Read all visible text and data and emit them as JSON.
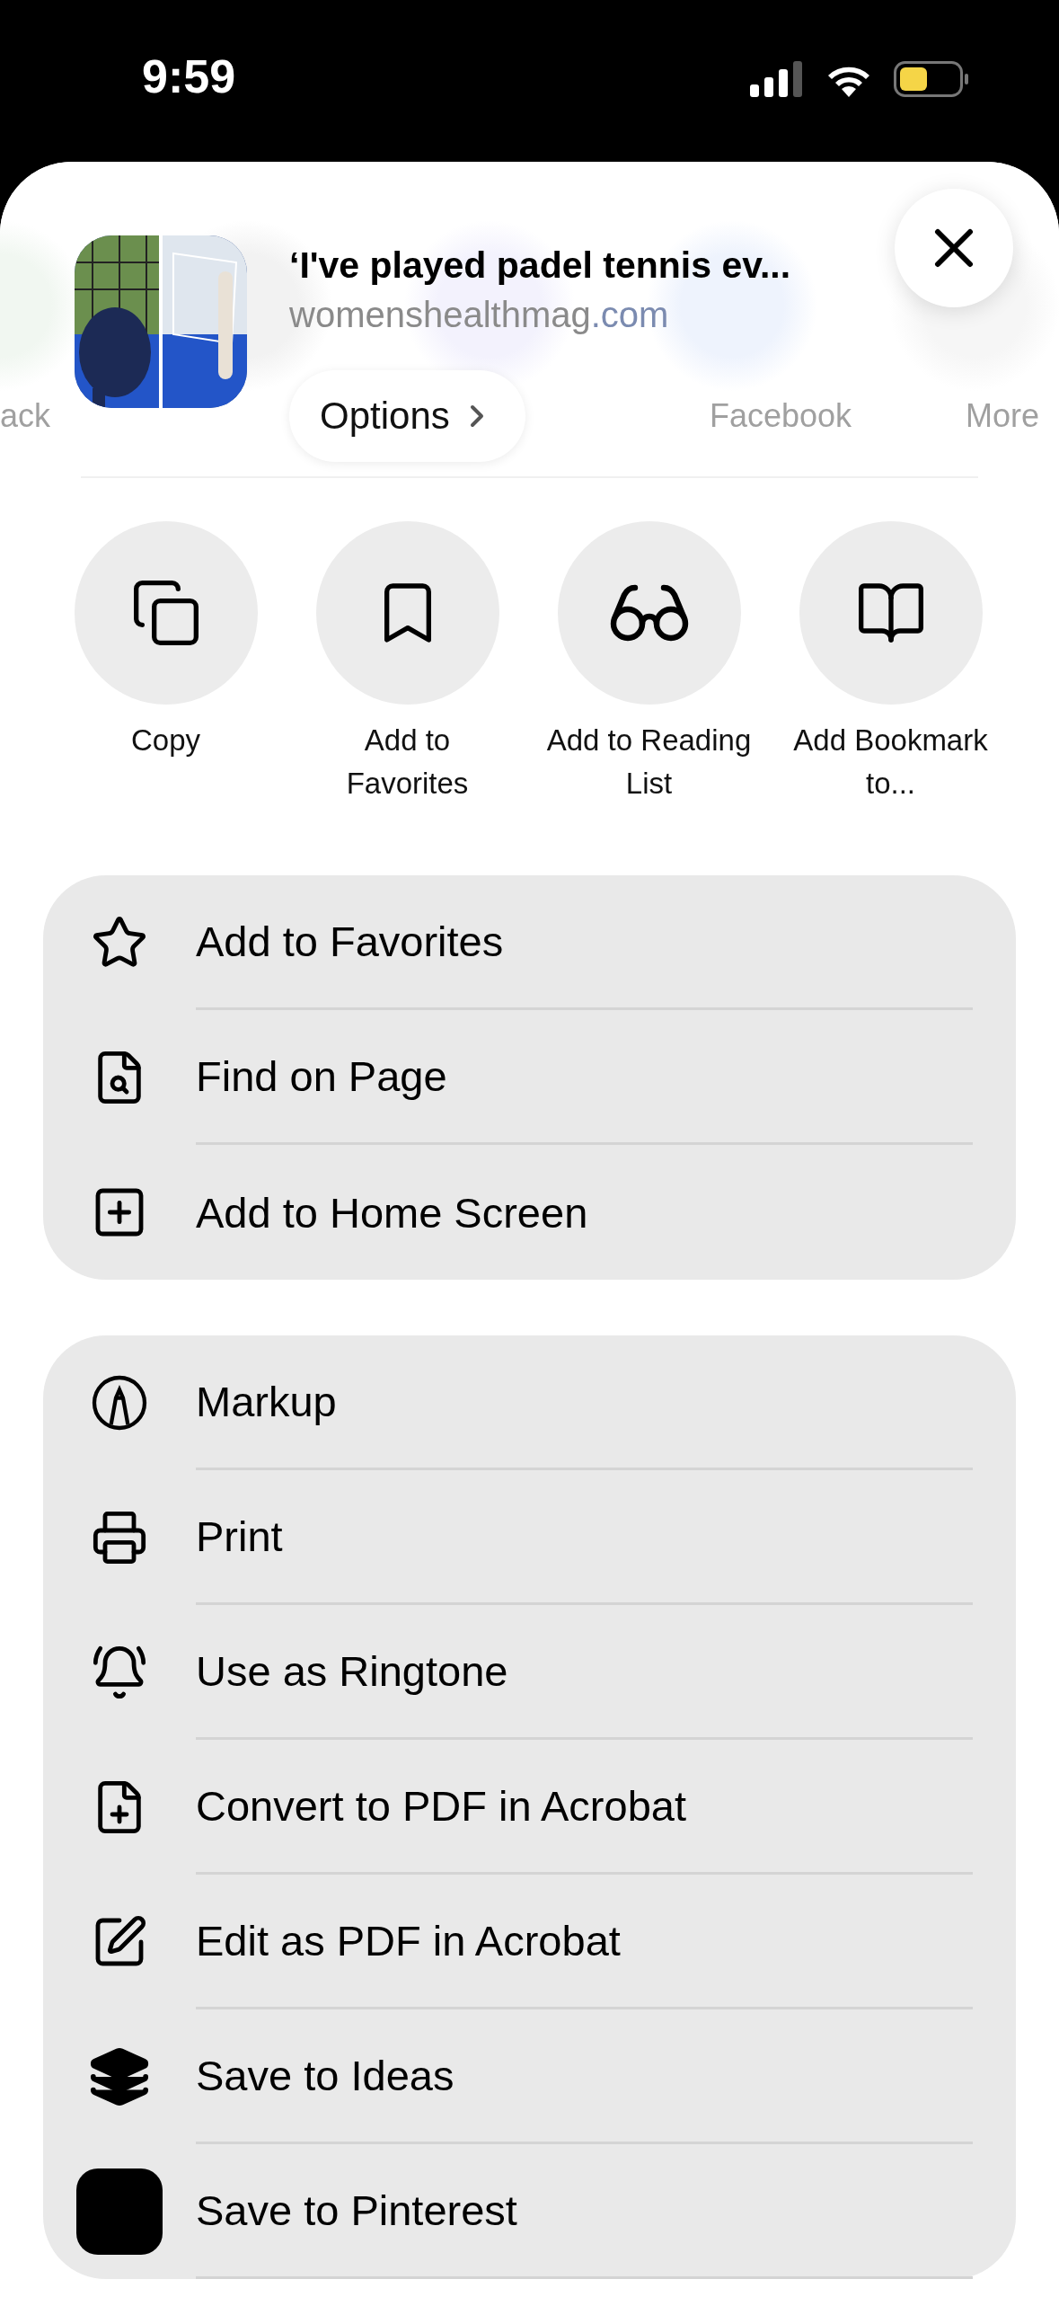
{
  "status_bar": {
    "time": "9:59"
  },
  "background_apps": [
    {
      "label": "ack"
    },
    {
      "label": "Facebook"
    },
    {
      "label": "More"
    }
  ],
  "header": {
    "title": "‘I've played padel tennis ev...",
    "domain_name": "womenshealthmag",
    "domain_tld": ".com",
    "options": "Options"
  },
  "actions": [
    {
      "label": "Copy"
    },
    {
      "label": "Add to Favorites"
    },
    {
      "label": "Add to Reading List"
    },
    {
      "label": "Add Bookmark to..."
    }
  ],
  "groups": [
    {
      "items": [
        {
          "label": "Add to Favorites"
        },
        {
          "label": "Find on Page"
        },
        {
          "label": "Add to Home Screen"
        }
      ]
    },
    {
      "items": [
        {
          "label": "Markup"
        },
        {
          "label": "Print"
        },
        {
          "label": "Use as Ringtone"
        },
        {
          "label": "Convert to PDF in Acrobat"
        },
        {
          "label": "Edit as PDF in Acrobat"
        },
        {
          "label": "Save to Ideas"
        },
        {
          "label": "Save to Pinterest"
        }
      ]
    }
  ]
}
